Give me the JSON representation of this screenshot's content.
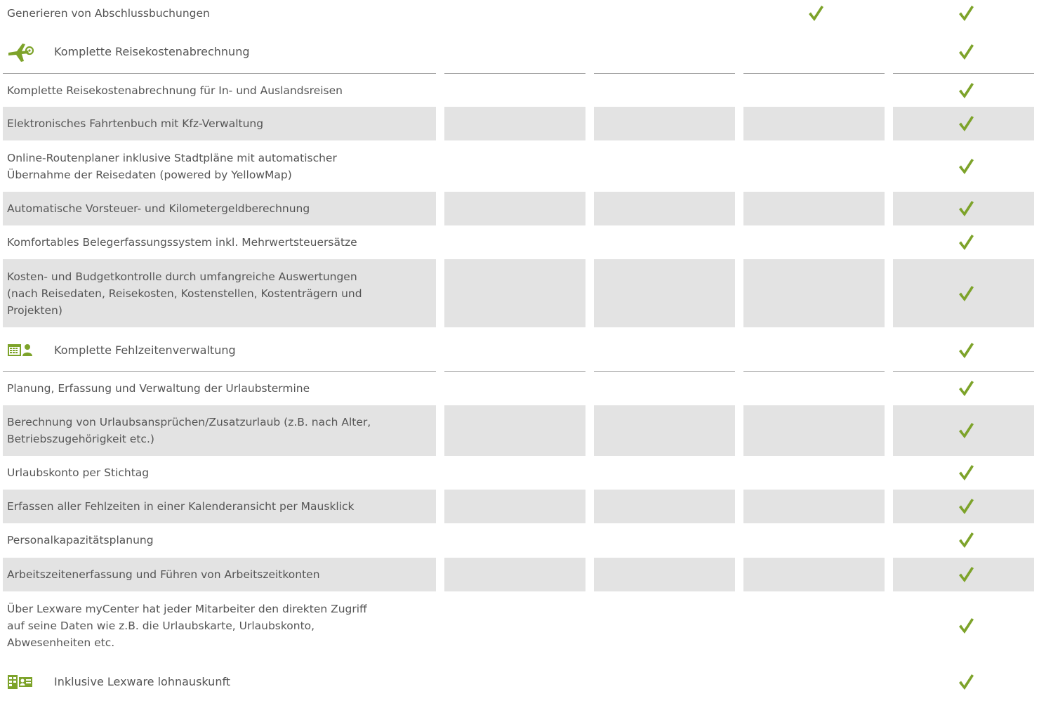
{
  "colors": {
    "accent": "#7da32a",
    "row_shade": "#e3e3e3",
    "text": "#555555",
    "divider": "#9a9a9a"
  },
  "rows": [
    {
      "kind": "feature",
      "text": "Generieren von Abschlussbuchungen",
      "checks": [
        false,
        false,
        false,
        true,
        true
      ],
      "shaded": false
    },
    {
      "kind": "header",
      "icon": "airplane-icon",
      "text": "Komplette Reisekostenabrechnung",
      "checks": [
        false,
        false,
        false,
        false,
        true
      ]
    },
    {
      "kind": "feature",
      "text": "Komplette Reisekostenabrechnung für In- und Auslandsreisen",
      "checks": [
        false,
        false,
        false,
        false,
        true
      ],
      "shaded": false
    },
    {
      "kind": "feature",
      "text": "Elektronisches Fahrtenbuch mit Kfz-Verwaltung",
      "checks": [
        false,
        false,
        false,
        false,
        true
      ],
      "shaded": true
    },
    {
      "kind": "feature",
      "text": "Online-Routenplaner inklusive Stadtpläne mit automatischer\nÜbernahme der Reisedaten (powered by YellowMap)",
      "checks": [
        false,
        false,
        false,
        false,
        true
      ],
      "shaded": false
    },
    {
      "kind": "feature",
      "text": "Automatische Vorsteuer- und Kilometergeldberechnung",
      "checks": [
        false,
        false,
        false,
        false,
        true
      ],
      "shaded": true
    },
    {
      "kind": "feature",
      "text": "Komfortables Belegerfassungssystem inkl. Mehrwertsteuersätze",
      "checks": [
        false,
        false,
        false,
        false,
        true
      ],
      "shaded": false
    },
    {
      "kind": "feature",
      "text": "Kosten- und Budgetkontrolle durch umfangreiche Auswertungen\n(nach Reisedaten, Reisekosten, Kostenstellen, Kostenträgern und\nProjekten)",
      "checks": [
        false,
        false,
        false,
        false,
        true
      ],
      "shaded": true
    },
    {
      "kind": "header",
      "icon": "calendar-person-icon",
      "text": "Komplette Fehlzeitenverwaltung",
      "checks": [
        false,
        false,
        false,
        false,
        true
      ]
    },
    {
      "kind": "feature",
      "text": "Planung, Erfassung und Verwaltung der Urlaubstermine",
      "checks": [
        false,
        false,
        false,
        false,
        true
      ],
      "shaded": false
    },
    {
      "kind": "feature",
      "text": "Berechnung von Urlaubsansprüchen/Zusatzurlaub (z.B. nach Alter,\nBetriebszugehörigkeit etc.)",
      "checks": [
        false,
        false,
        false,
        false,
        true
      ],
      "shaded": true
    },
    {
      "kind": "feature",
      "text": "Urlaubskonto per Stichtag",
      "checks": [
        false,
        false,
        false,
        false,
        true
      ],
      "shaded": false
    },
    {
      "kind": "feature",
      "text": "Erfassen aller Fehlzeiten in einer Kalenderansicht per Mausklick",
      "checks": [
        false,
        false,
        false,
        false,
        true
      ],
      "shaded": true
    },
    {
      "kind": "feature",
      "text": "Personalkapazitätsplanung",
      "checks": [
        false,
        false,
        false,
        false,
        true
      ],
      "shaded": false
    },
    {
      "kind": "feature",
      "text": "Arbeitszeitenerfassung und Führen von Arbeitszeitkonten",
      "checks": [
        false,
        false,
        false,
        false,
        true
      ],
      "shaded": true
    },
    {
      "kind": "feature",
      "text": "Über Lexware myCenter hat jeder Mitarbeiter den direkten Zugriff\nauf seine Daten wie z.B. die Urlaubskarte, Urlaubskonto,\nAbwesenheiten etc.",
      "checks": [
        false,
        false,
        false,
        false,
        true
      ],
      "shaded": false
    },
    {
      "kind": "header",
      "icon": "payslip-info-icon",
      "text": "Inklusive Lexware lohnauskunft",
      "checks": [
        false,
        false,
        false,
        false,
        true
      ],
      "underline": false
    }
  ]
}
